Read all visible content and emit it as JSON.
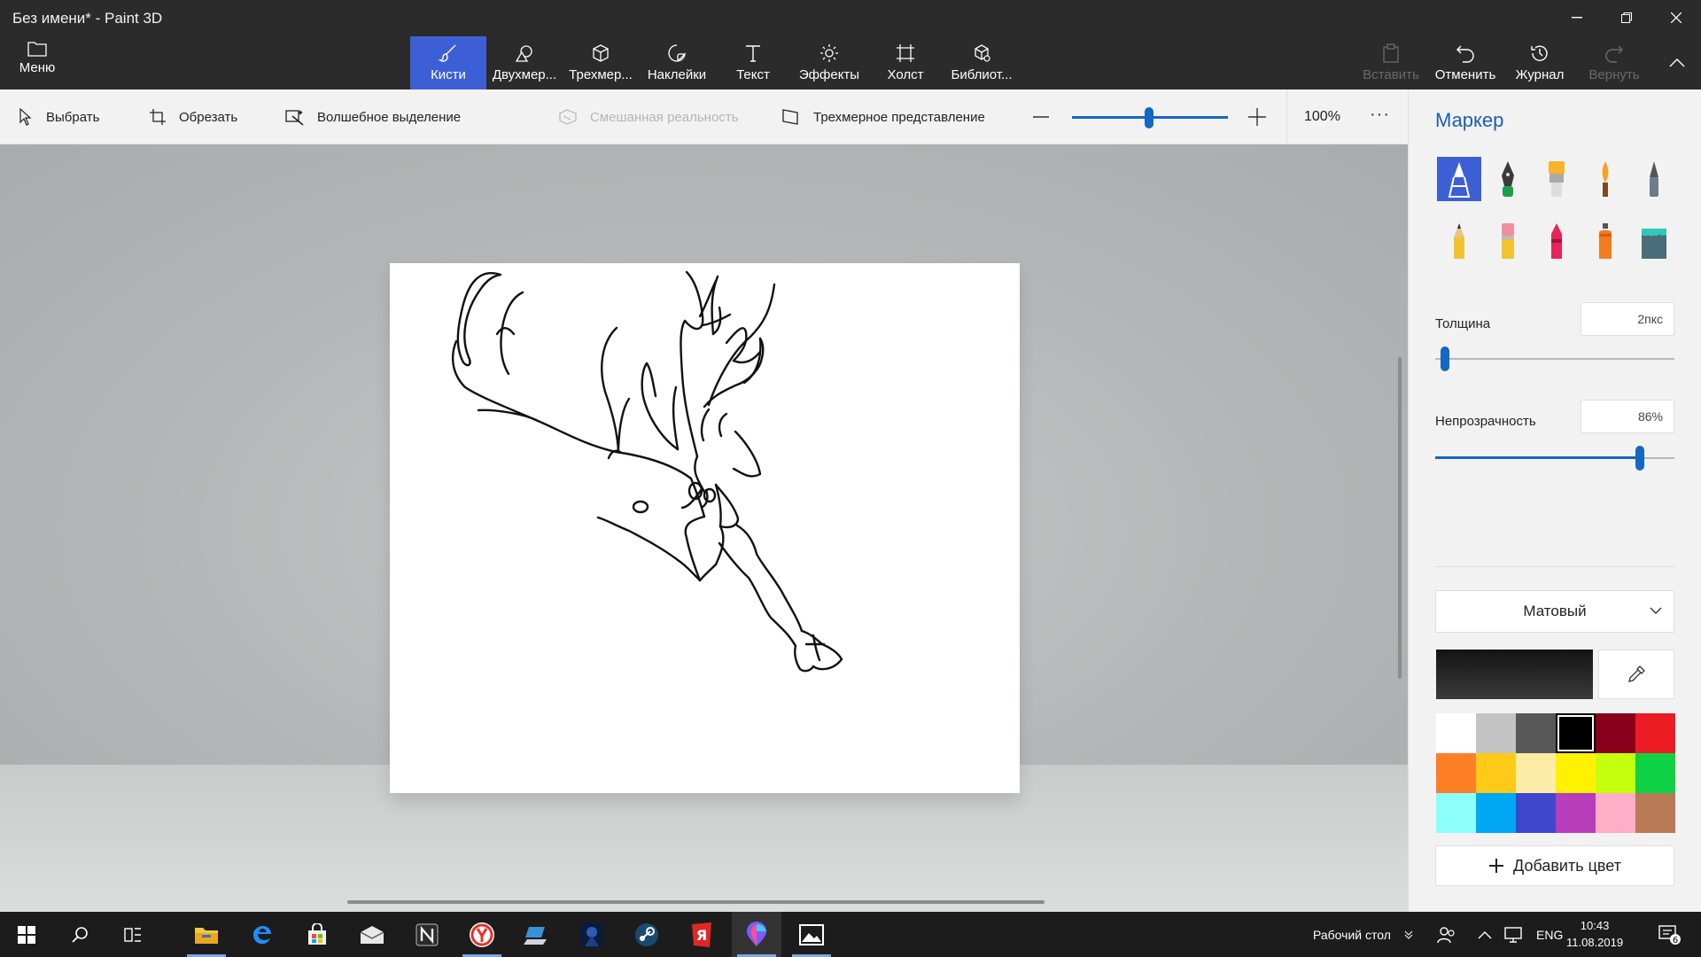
{
  "window": {
    "title": "Без имени* - Paint 3D"
  },
  "ribbon": {
    "menu_label": "Меню",
    "tabs": [
      {
        "label": "Кисти",
        "icon": "brush-icon",
        "active": true
      },
      {
        "label": "Двухмер...",
        "icon": "2d-shapes-icon"
      },
      {
        "label": "Трехмер...",
        "icon": "3d-shapes-icon"
      },
      {
        "label": "Наклейки",
        "icon": "stickers-icon"
      },
      {
        "label": "Текст",
        "icon": "text-icon"
      },
      {
        "label": "Эффекты",
        "icon": "effects-icon"
      },
      {
        "label": "Холст",
        "icon": "canvas-icon"
      },
      {
        "label": "Библиот...",
        "icon": "library-icon"
      }
    ],
    "actions": [
      {
        "label": "Вставить",
        "icon": "paste-icon",
        "enabled": false
      },
      {
        "label": "Отменить",
        "icon": "undo-icon",
        "enabled": true
      },
      {
        "label": "Журнал",
        "icon": "history-icon",
        "enabled": true
      },
      {
        "label": "Вернуть",
        "icon": "redo-icon",
        "enabled": false
      }
    ]
  },
  "toolbar": {
    "select": "Выбрать",
    "crop": "Обрезать",
    "magic_select": "Волшебное выделение",
    "mixed_reality": "Смешанная реальность",
    "view_3d": "Трехмерное представление",
    "zoom_value": "100%",
    "more": "···"
  },
  "panel": {
    "title": "Маркер",
    "brushes": [
      "marker-icon",
      "calligraphy-pen-icon",
      "oil-brush-icon",
      "watercolor-icon",
      "pixel-pen-icon",
      "pencil-icon",
      "eraser-icon",
      "crayon-icon",
      "spray-can-icon",
      "fill-bucket-icon"
    ],
    "thickness_label": "Толщина",
    "thickness_value": "2пкс",
    "thickness_level": 0.03,
    "opacity_label": "Непрозрачность",
    "opacity_value": "86%",
    "opacity_level": 0.86,
    "finish": "Матовый",
    "current_color": "#141414",
    "palette": [
      "#ffffff",
      "#c3c3c3",
      "#585858",
      "#000000",
      "#88001b",
      "#ec1c24",
      "#ff7f27",
      "#ffca18",
      "#fdeca6",
      "#fff200",
      "#c4ff0e",
      "#0ed145",
      "#8cfffb",
      "#00a8f3",
      "#3f48cc",
      "#b83dba",
      "#ffaec8",
      "#b97a56"
    ],
    "selected_color_index": 3,
    "add_color": "Добавить цвет"
  },
  "taskbar": {
    "apps": [
      "windows-start-icon",
      "search-icon",
      "task-view-icon",
      "file-explorer-icon",
      "edge-icon",
      "store-icon",
      "mail-icon",
      "notion-icon",
      "yandex-browser-icon",
      "network-app-icon",
      "game-icon",
      "steam-icon",
      "yandex-icon",
      "paint3d-icon",
      "photos-icon"
    ],
    "desktop_label": "Рабочий стол",
    "lang": "ENG",
    "time": "10:43",
    "date": "11.08.2019",
    "notifications": "6"
  }
}
